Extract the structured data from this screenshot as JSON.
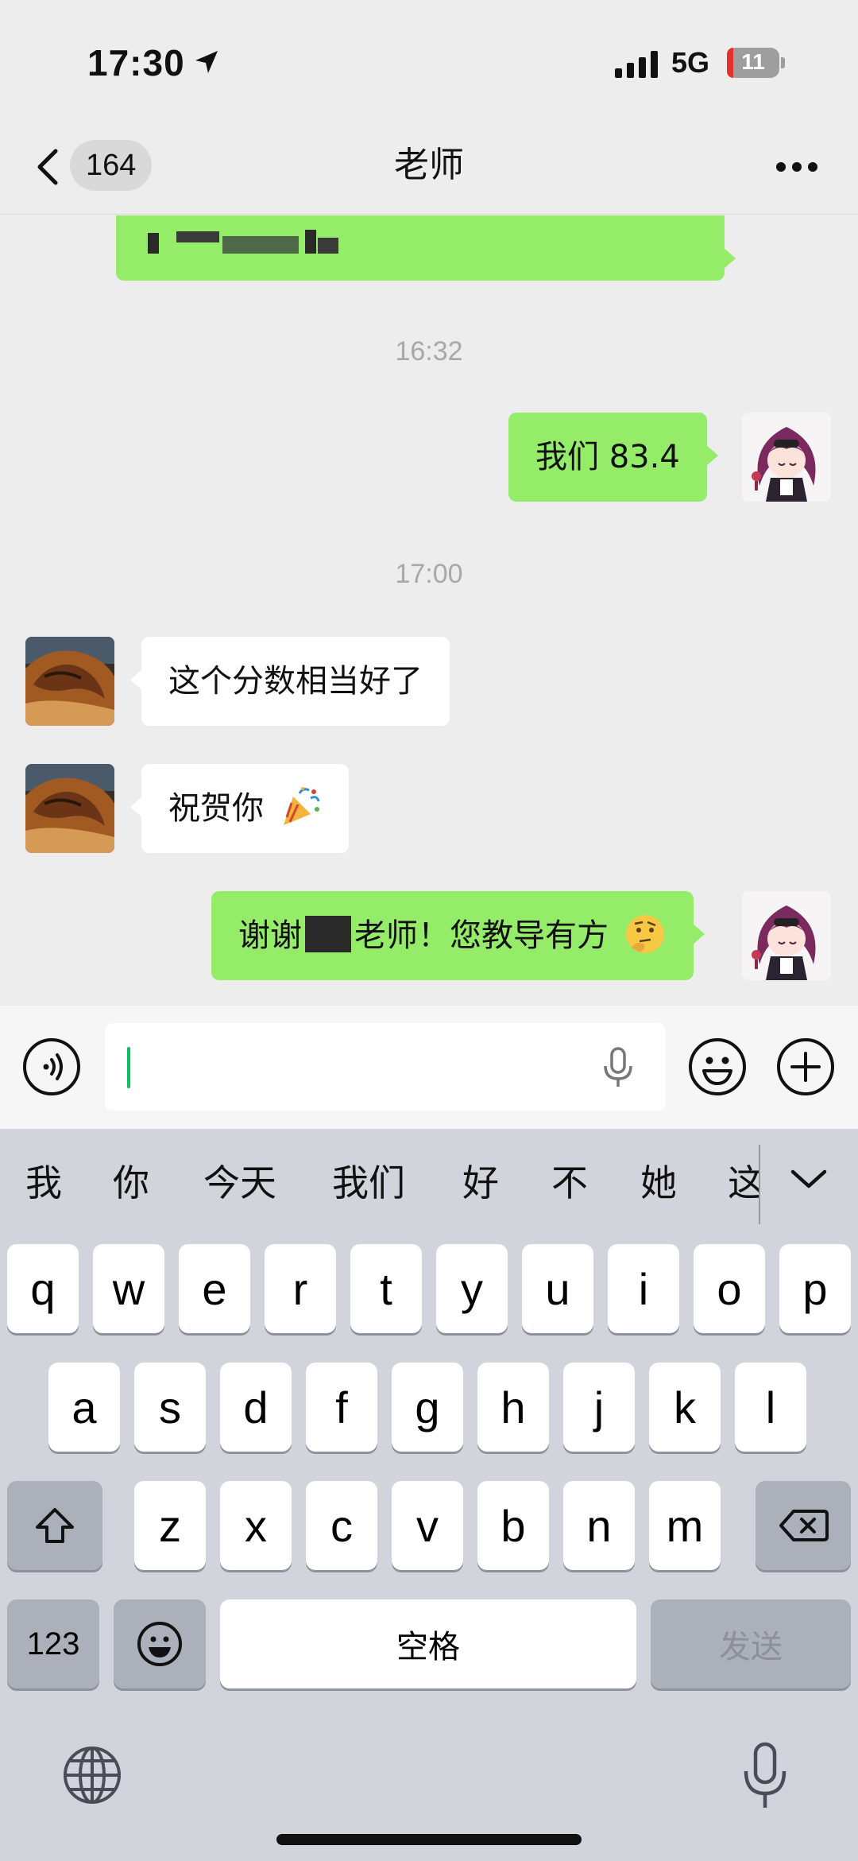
{
  "status_bar": {
    "time": "17:30",
    "network": "5G",
    "battery": "11",
    "battery_color": "#e5302d",
    "icons": [
      "location-arrow-icon",
      "signal-icon",
      "battery-icon"
    ]
  },
  "header": {
    "unread_count": "164",
    "title": "老师",
    "icons": [
      "back-chevron-icon",
      "more-dots-icon"
    ]
  },
  "messages": [
    {
      "type": "outgoing",
      "text": "",
      "note": "partially visible, blurred"
    },
    {
      "type": "timestamp",
      "text": "16:32"
    },
    {
      "type": "outgoing",
      "text": "我们 83.4"
    },
    {
      "type": "timestamp",
      "text": "17:00"
    },
    {
      "type": "incoming",
      "text": "这个分数相当好了"
    },
    {
      "type": "incoming",
      "text": "祝贺你",
      "emoji": "party-popper-emoji"
    },
    {
      "type": "outgoing",
      "text_before": "谢谢",
      "text_after": "老师！您教导有方",
      "emoji": "thinking-emoji"
    }
  ],
  "input_bar": {
    "value": "",
    "icons": [
      "voice-mode-icon",
      "mic-icon",
      "emoji-icon",
      "plus-icon"
    ]
  },
  "keyboard": {
    "candidates": [
      "我",
      "你",
      "今天",
      "我们",
      "好",
      "不",
      "她",
      "这"
    ],
    "rows": [
      [
        "q",
        "w",
        "e",
        "r",
        "t",
        "y",
        "u",
        "i",
        "o",
        "p"
      ],
      [
        "a",
        "s",
        "d",
        "f",
        "g",
        "h",
        "j",
        "k",
        "l"
      ],
      [
        "z",
        "x",
        "c",
        "v",
        "b",
        "n",
        "m"
      ]
    ],
    "numbers_label": "123",
    "space_label": "空格",
    "send_label": "发送",
    "icons": [
      "shift-icon",
      "backspace-icon",
      "emoji-key-icon",
      "globe-icon",
      "dictation-mic-icon",
      "collapse-chevron-icon"
    ]
  },
  "colors": {
    "chat_background": "#ededed",
    "outgoing_bubble": "#95ec69",
    "incoming_bubble": "#ffffff",
    "keyboard_background": "#d1d4db",
    "caret": "#07c160"
  }
}
